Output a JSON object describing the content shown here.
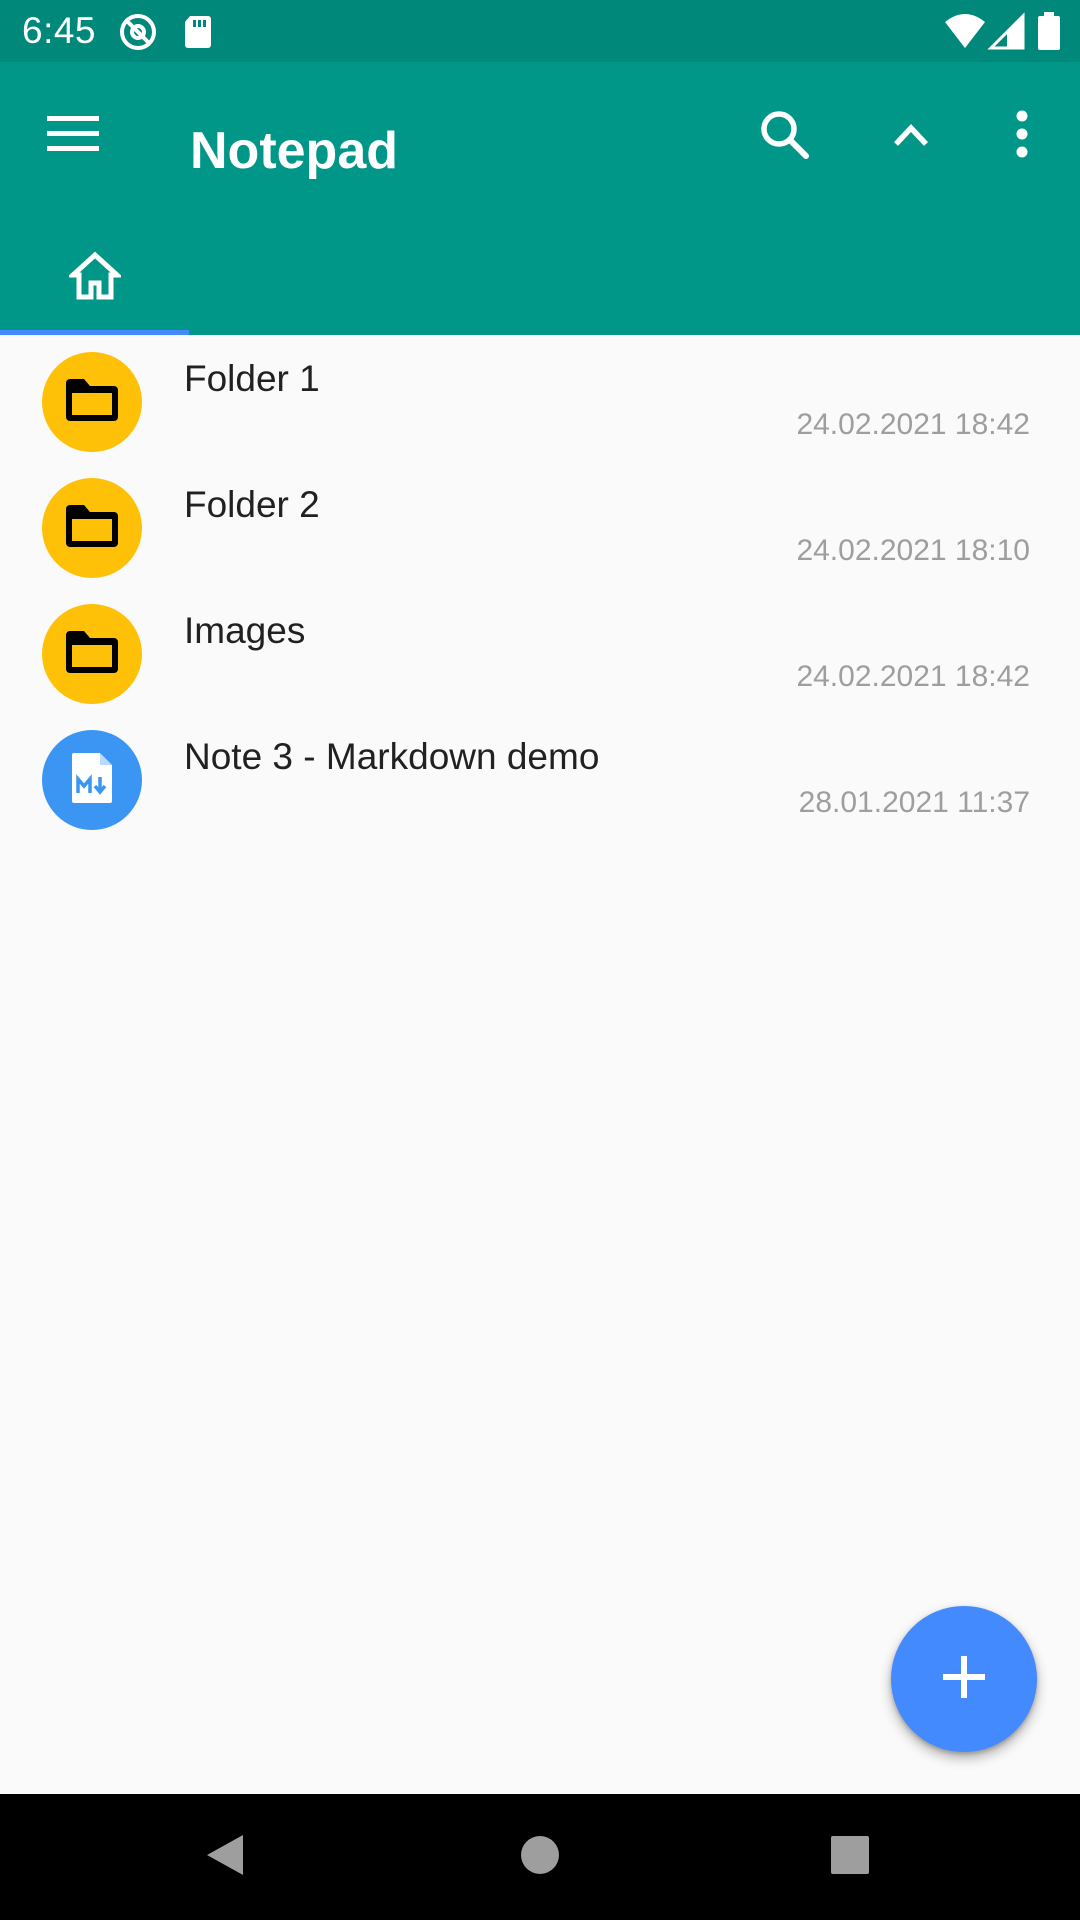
{
  "status_bar": {
    "time": "6:45",
    "icons": [
      "at-sign-icon",
      "sd-card-icon",
      "wifi-icon",
      "cell-signal-icon",
      "battery-icon"
    ]
  },
  "app_bar": {
    "title": "Notepad",
    "color": "#009688",
    "actions": [
      "menu-icon",
      "search-icon",
      "chevron-up-icon",
      "more-vert-icon"
    ]
  },
  "tabs": [
    {
      "icon": "home-icon",
      "selected": true
    }
  ],
  "items": [
    {
      "type": "folder",
      "icon": "folder-icon",
      "name": "Folder 1",
      "date": "24.02.2021 18:42"
    },
    {
      "type": "folder",
      "icon": "folder-icon",
      "name": "Folder 2",
      "date": "24.02.2021 18:10"
    },
    {
      "type": "folder",
      "icon": "folder-icon",
      "name": "Images",
      "date": "24.02.2021 18:42"
    },
    {
      "type": "note",
      "icon": "markdown-file-icon",
      "name": "Note 3 - Markdown demo",
      "date": "28.01.2021 11:37"
    }
  ],
  "fab": {
    "icon": "plus-icon",
    "color": "#448aff"
  },
  "colors": {
    "folder": "#ffc107",
    "note": "#3b96f3",
    "tab_indicator": "#448aff",
    "status_bar": "#00897b"
  },
  "nav_bar": [
    "back-icon",
    "home-circle-icon",
    "recents-icon"
  ]
}
